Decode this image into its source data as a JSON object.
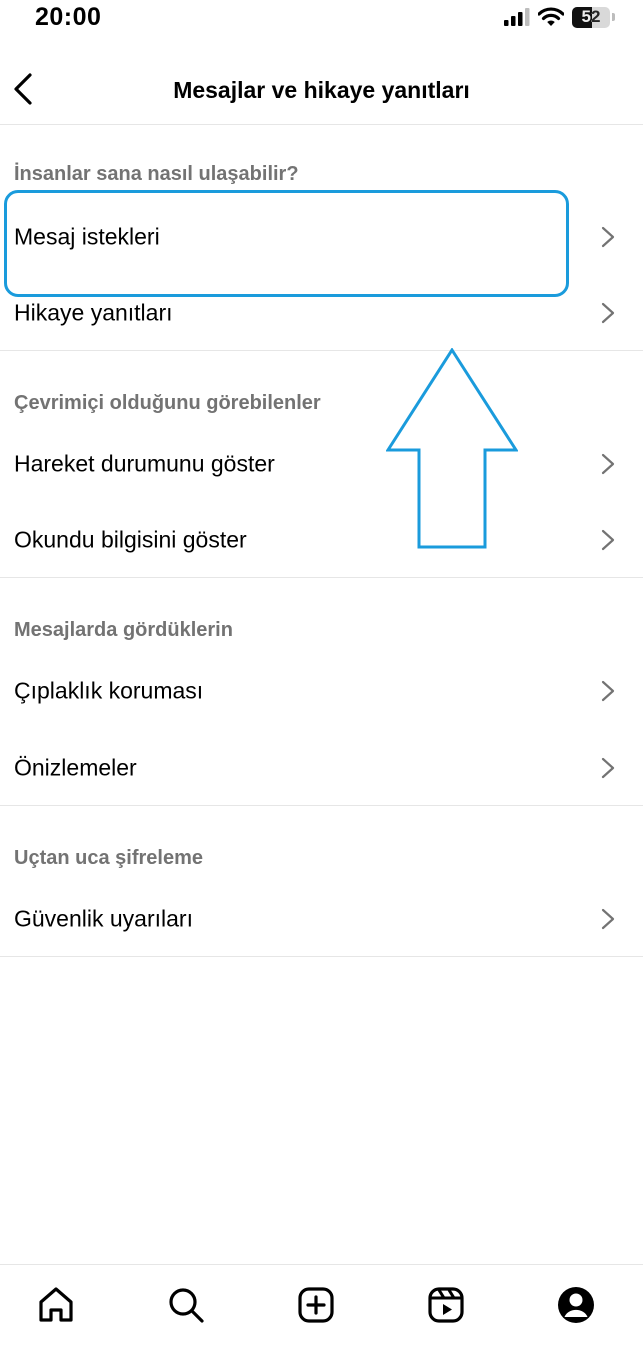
{
  "status_bar": {
    "time": "20:00",
    "battery_level": "52",
    "battery_fraction": 0.52,
    "icons": [
      "signal-icon",
      "wifi-icon",
      "battery-icon"
    ]
  },
  "header": {
    "title": "Mesajlar ve hikaye yanıtları",
    "back_icon": "chevron-left-icon"
  },
  "sections": [
    {
      "header": "İnsanlar sana nasıl ulaşabilir?",
      "items": [
        {
          "label": "Mesaj istekleri"
        },
        {
          "label": "Hikaye yanıtları"
        }
      ]
    },
    {
      "header": "Çevrimiçi olduğunu görebilenler",
      "items": [
        {
          "label": "Hareket durumunu göster"
        },
        {
          "label": "Okundu bilgisini göster"
        }
      ]
    },
    {
      "header": "Mesajlarda gördüklerin",
      "items": [
        {
          "label": "Çıplaklık koruması"
        },
        {
          "label": "Önizlemeler"
        }
      ]
    },
    {
      "header": "Uçtan uca şifreleme",
      "items": [
        {
          "label": "Güvenlik uyarıları"
        }
      ]
    }
  ],
  "annotation": {
    "color": "#1a9bdc",
    "highlighted_item": "Mesaj istekleri",
    "arrow_direction": "up"
  },
  "tab_bar": {
    "icons": [
      "home-icon",
      "search-icon",
      "create-icon",
      "reels-icon",
      "profile-icon"
    ]
  },
  "colors": {
    "section_header": "#737373",
    "divider": "#e6e6e6",
    "chevron": "#737373"
  }
}
